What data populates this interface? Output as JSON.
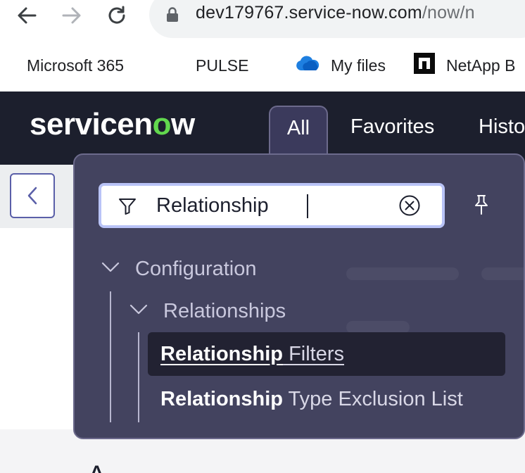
{
  "browser": {
    "url_main": "dev179767.service-now.com",
    "url_path": "/now/n",
    "bookmarks": [
      {
        "label": "Microsoft 365",
        "icon": "microsoft-icon"
      },
      {
        "label": "PULSE",
        "icon": "microsoft-icon"
      },
      {
        "label": "My files",
        "icon": "onedrive-cloud-icon"
      },
      {
        "label": "NetApp B",
        "icon": "netapp-icon"
      }
    ]
  },
  "header": {
    "logo_pre": "servicen",
    "logo_o": "o",
    "logo_post": "w",
    "tabs": [
      "All",
      "Favorites",
      "Histo"
    ]
  },
  "menu": {
    "search_value": "Relationship",
    "category": "Configuration",
    "subcategory": "Relationships",
    "items": [
      {
        "match": "Relationship",
        "rest": " Filters",
        "active": true
      },
      {
        "match": "Relationship",
        "rest": " Type Exclusion List",
        "active": false
      }
    ]
  },
  "page": {
    "bottom_heading": "A"
  },
  "colors": {
    "header_bg": "#1c1f2d",
    "panel_bg": "#43435f",
    "logo_accent": "#62d84e",
    "search_focus": "#b9c3f7"
  }
}
